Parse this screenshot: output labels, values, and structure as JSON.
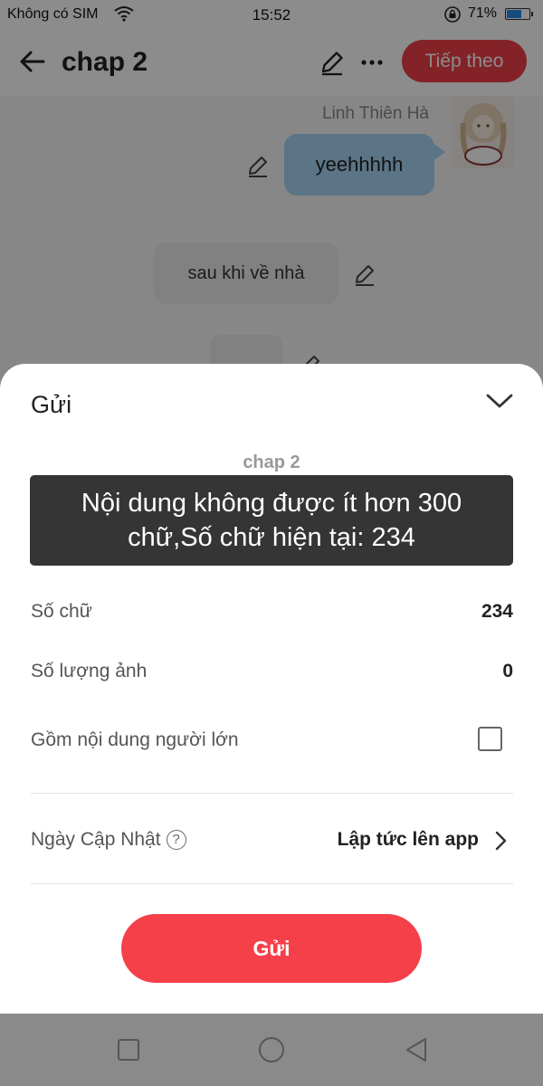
{
  "status_bar": {
    "carrier": "Không có SIM",
    "time": "15:52",
    "battery_text": "71%",
    "battery_level": 0.71
  },
  "topbar": {
    "title": "chap 2",
    "next_label": "Tiếp theo",
    "accent_color": "#ee4047"
  },
  "chat": {
    "sender_name": "Linh Thiên Hà",
    "message_1": "yeehhhhh",
    "message_2": "sau khi về nhà"
  },
  "sheet": {
    "title": "Gửi",
    "chapter_name": "chap 2",
    "words_label": "Số chữ",
    "words_value": "234",
    "images_label": "Số lượng ảnh",
    "images_value": "0",
    "adult_label": "Gồm nội dung người lớn",
    "adult_checked": false,
    "date_label": "Ngày Cập Nhật",
    "date_value": "Lập tức lên app",
    "help_glyph": "?",
    "send_label": "Gửi",
    "send_color": "#f5404a"
  },
  "toast": {
    "line1": "Nội dung không được ít hơn 300",
    "line2": "chữ,Số chữ hiện tại: 234"
  },
  "icons": [
    "wifi-icon",
    "lock-rotation-icon",
    "battery-icon",
    "back-arrow-icon",
    "pencil-icon",
    "more-icon",
    "chevron-down-icon",
    "help-icon",
    "chevron-right-icon",
    "recent-apps-icon",
    "home-icon",
    "nav-back-icon"
  ]
}
